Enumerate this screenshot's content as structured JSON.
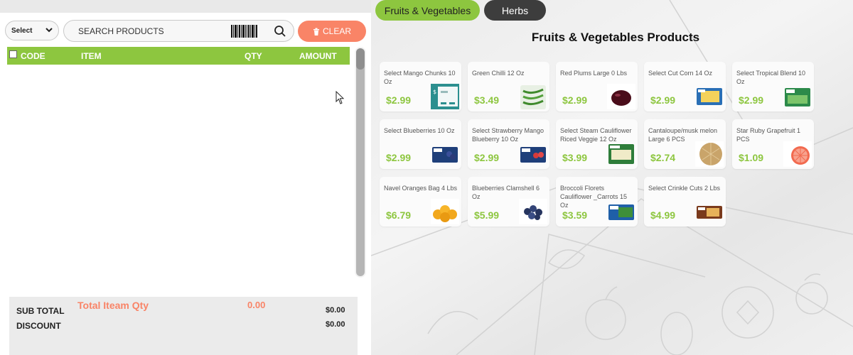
{
  "pos": {
    "select_label": "Select",
    "search_placeholder": "SEARCH PRODUCTS",
    "clear_label": "CLEAR",
    "columns": {
      "code": "CODE",
      "item": "ITEM",
      "qty": "QTY",
      "amount": "AMOUNT"
    },
    "totals": {
      "qty_label": "Total Iteam Qty",
      "qty_value": "0.00",
      "sub_total_label": "SUB TOTAL",
      "sub_total_value": "$0.00",
      "discount_label": "DISCOUNT",
      "discount_value": "$0.00"
    }
  },
  "tabs": [
    {
      "label": "Fruits & Vegetables",
      "active": true
    },
    {
      "label": "Herbs",
      "active": false
    }
  ],
  "catalog": {
    "title": "Fruits & Vegetables Products",
    "products": [
      {
        "name": "Select Mango Chunks 10 Oz",
        "price": "$2.99",
        "thumb": "mango-package-icon"
      },
      {
        "name": "Green Chilli 12 Oz",
        "price": "$3.49",
        "thumb": "chilli-bag-icon"
      },
      {
        "name": "Red Plums Large 0 Lbs",
        "price": "$2.99",
        "thumb": "plum-icon"
      },
      {
        "name": "Select Cut Corn 14 Oz",
        "price": "$2.99",
        "thumb": "corn-bag-icon"
      },
      {
        "name": "Select Tropical Blend 10 Oz",
        "price": "$2.99",
        "thumb": "tropical-bag-icon"
      },
      {
        "name": "Select Blueberries 10 Oz",
        "price": "$2.99",
        "thumb": "blueberry-bag-icon"
      },
      {
        "name": "Select Strawberry Mango Blueberry 10 Oz",
        "price": "$2.99",
        "thumb": "berry-bag-icon"
      },
      {
        "name": "Select Steam Cauliflower Riced Veggie 12 Oz",
        "price": "$3.99",
        "thumb": "cauliflower-bag-icon"
      },
      {
        "name": "Cantaloupe/musk melon Large 6 PCS",
        "price": "$2.74",
        "thumb": "cantaloupe-icon"
      },
      {
        "name": "Star Ruby Grapefruit 1 PCS",
        "price": "$1.09",
        "thumb": "grapefruit-icon"
      },
      {
        "name": "Navel Oranges Bag 4 Lbs",
        "price": "$6.79",
        "thumb": "oranges-icon"
      },
      {
        "name": "Blueberries Clamshell 6 Oz",
        "price": "$5.99",
        "thumb": "blueberries-icon"
      },
      {
        "name": "Broccoli Florets Cauliflower _Carrots 15 Oz",
        "price": "$3.59",
        "thumb": "broccoli-bag-icon"
      },
      {
        "name": "Select Crinkle Cuts 2 Lbs",
        "price": "$4.99",
        "thumb": "crinkle-cuts-bag-icon"
      }
    ]
  },
  "colors": {
    "accent_green": "#8dc63f",
    "clear_orange": "#f98467",
    "herbs_tab": "#3d3d3d"
  }
}
